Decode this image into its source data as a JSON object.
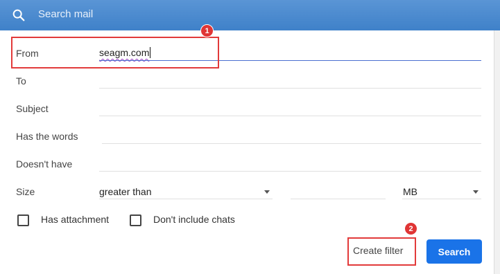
{
  "header": {
    "search_placeholder": "Search mail",
    "search_icon": "search-icon"
  },
  "form": {
    "from_label": "From",
    "from_value": "seagm.com",
    "to_label": "To",
    "subject_label": "Subject",
    "has_words_label": "Has the words",
    "doesnt_have_label": "Doesn't have",
    "size_label": "Size",
    "size_operator": "greater than",
    "size_unit": "MB",
    "has_attachment_label": "Has attachment",
    "dont_include_chats_label": "Don't include chats"
  },
  "actions": {
    "create_filter_label": "Create filter",
    "search_label": "Search"
  },
  "annotations": {
    "badge_1": "1",
    "badge_2": "2"
  },
  "colors": {
    "header_blue": "#4a8ad0",
    "search_button": "#1a73e8",
    "highlight_red": "#e23a3a"
  }
}
